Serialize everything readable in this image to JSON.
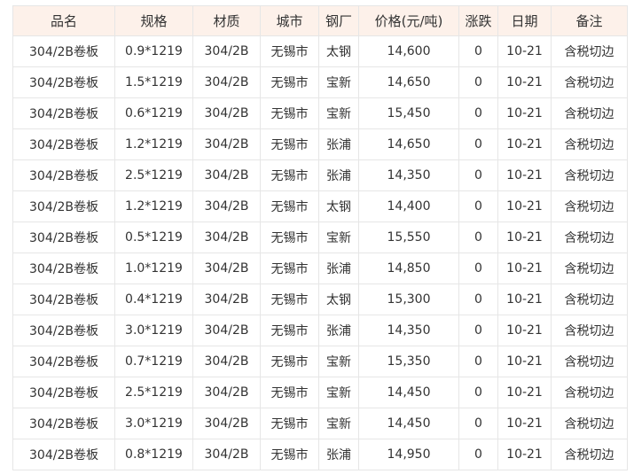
{
  "table": {
    "headers": [
      "品名",
      "规格",
      "材质",
      "城市",
      "钢厂",
      "价格(元/吨)",
      "涨跌",
      "日期",
      "备注"
    ],
    "rows": [
      [
        "304/2B卷板",
        "0.9*1219",
        "304/2B",
        "无锡市",
        "太钢",
        "14,600",
        "0",
        "10-21",
        "含税切边"
      ],
      [
        "304/2B卷板",
        "1.5*1219",
        "304/2B",
        "无锡市",
        "宝新",
        "14,650",
        "0",
        "10-21",
        "含税切边"
      ],
      [
        "304/2B卷板",
        "0.6*1219",
        "304/2B",
        "无锡市",
        "宝新",
        "15,450",
        "0",
        "10-21",
        "含税切边"
      ],
      [
        "304/2B卷板",
        "1.2*1219",
        "304/2B",
        "无锡市",
        "张浦",
        "14,650",
        "0",
        "10-21",
        "含税切边"
      ],
      [
        "304/2B卷板",
        "2.5*1219",
        "304/2B",
        "无锡市",
        "张浦",
        "14,350",
        "0",
        "10-21",
        "含税切边"
      ],
      [
        "304/2B卷板",
        "1.2*1219",
        "304/2B",
        "无锡市",
        "太钢",
        "14,400",
        "0",
        "10-21",
        "含税切边"
      ],
      [
        "304/2B卷板",
        "0.5*1219",
        "304/2B",
        "无锡市",
        "宝新",
        "15,550",
        "0",
        "10-21",
        "含税切边"
      ],
      [
        "304/2B卷板",
        "1.0*1219",
        "304/2B",
        "无锡市",
        "张浦",
        "14,850",
        "0",
        "10-21",
        "含税切边"
      ],
      [
        "304/2B卷板",
        "0.4*1219",
        "304/2B",
        "无锡市",
        "太钢",
        "15,300",
        "0",
        "10-21",
        "含税切边"
      ],
      [
        "304/2B卷板",
        "3.0*1219",
        "304/2B",
        "无锡市",
        "张浦",
        "14,350",
        "0",
        "10-21",
        "含税切边"
      ],
      [
        "304/2B卷板",
        "0.7*1219",
        "304/2B",
        "无锡市",
        "宝新",
        "15,350",
        "0",
        "10-21",
        "含税切边"
      ],
      [
        "304/2B卷板",
        "2.5*1219",
        "304/2B",
        "无锡市",
        "宝新",
        "14,450",
        "0",
        "10-21",
        "含税切边"
      ],
      [
        "304/2B卷板",
        "3.0*1219",
        "304/2B",
        "无锡市",
        "宝新",
        "14,450",
        "0",
        "10-21",
        "含税切边"
      ],
      [
        "304/2B卷板",
        "0.8*1219",
        "304/2B",
        "无锡市",
        "张浦",
        "14,950",
        "0",
        "10-21",
        "含税切边"
      ]
    ]
  },
  "colors": {
    "header_bg": "#fdf1ea",
    "border": "#e6e6e6",
    "text": "#333333"
  }
}
